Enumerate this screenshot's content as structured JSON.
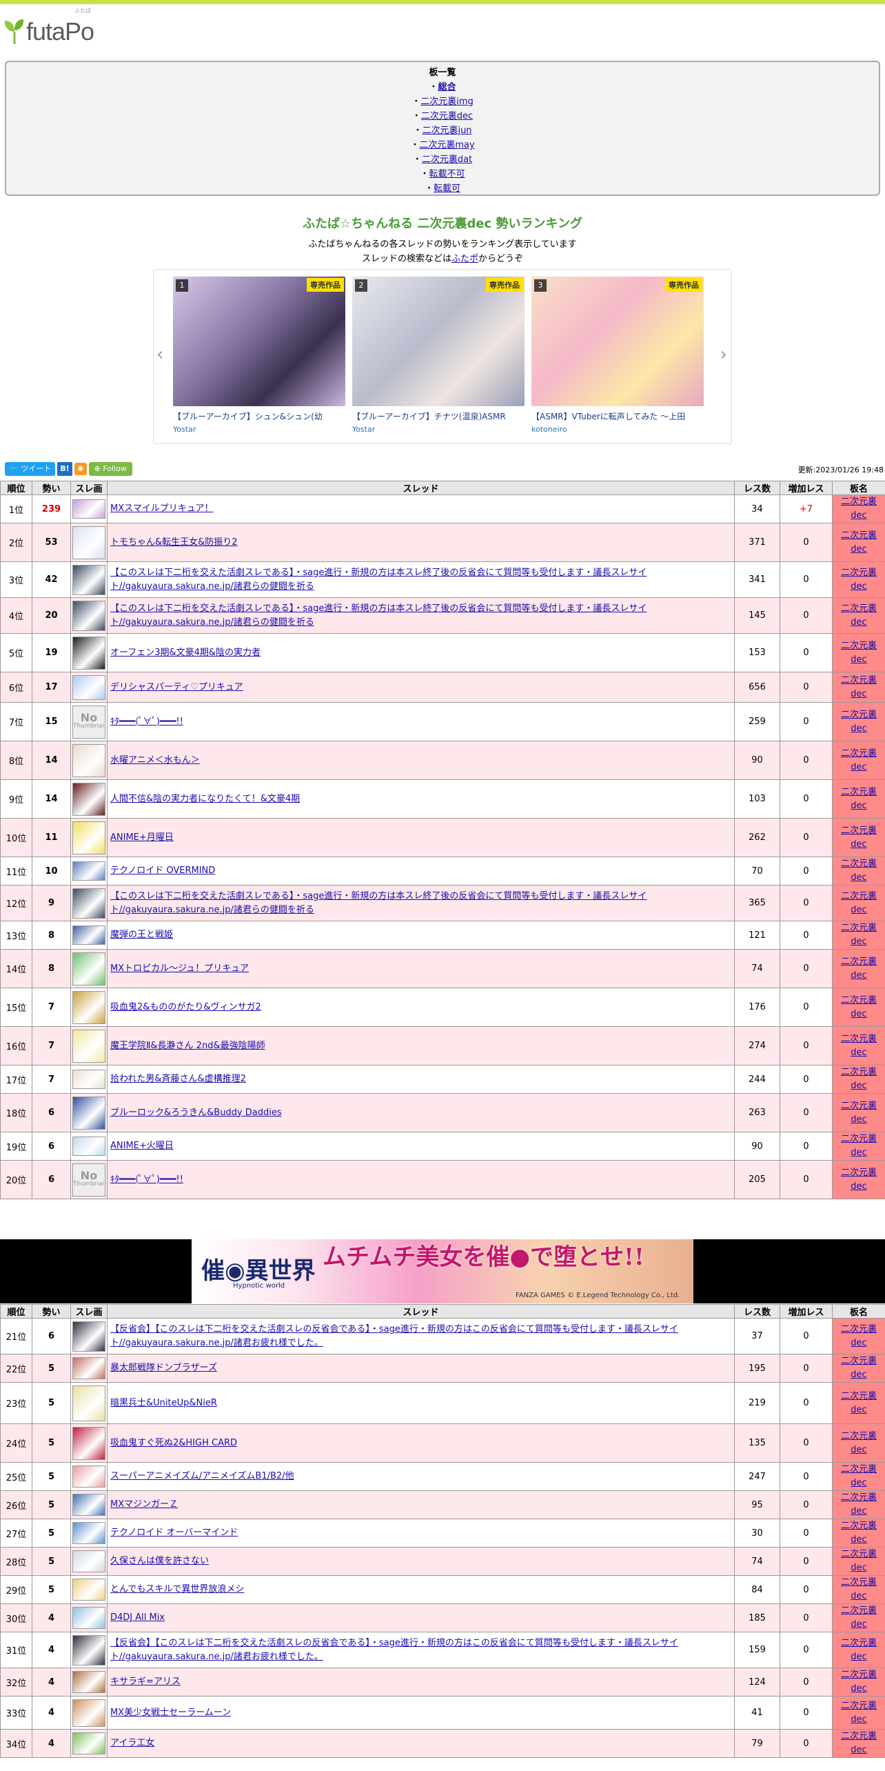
{
  "site": {
    "logo_text": "futaPo",
    "logo_ruby": "ふたぽ"
  },
  "boards": {
    "title": "板一覧",
    "items": [
      {
        "label": "総合",
        "current": true
      },
      {
        "label": "二次元裏img"
      },
      {
        "label": "二次元裏dec"
      },
      {
        "label": "二次元裏jun"
      },
      {
        "label": "二次元裏may"
      },
      {
        "label": "二次元裏dat"
      },
      {
        "label": "転載不可"
      },
      {
        "label": "転載可"
      }
    ]
  },
  "page": {
    "title": "ふたば☆ちゃんねる 二次元裏dec 勢いランキング",
    "desc1": "ふたばちゃんねるの各スレッドの勢いをランキング表示しています",
    "desc2_pre": "スレッドの検索などは",
    "desc2_link": "ふたポ",
    "desc2_post": "からどうぞ",
    "updated": "更新:2023/01/26 19:48"
  },
  "carousel": {
    "badge": "専売作品",
    "items": [
      {
        "rank": "1",
        "name": "【ブルーアーカイブ】シュン&シュン(幼",
        "maker": "Yostar"
      },
      {
        "rank": "2",
        "name": "【ブルーアーカイブ】チナツ(温泉)ASMR",
        "maker": "Yostar"
      },
      {
        "rank": "3",
        "name": "【ASMR】VTuberに転声してみた 〜上田",
        "maker": "kotoneiro"
      }
    ]
  },
  "social": {
    "tweet": "ツイート",
    "hatena": "B!",
    "follow": "Follow"
  },
  "table_headers": {
    "rank": "順位",
    "ikioi": "勢い",
    "thumb": "スレ画",
    "thread": "スレッド",
    "res": "レス数",
    "incr": "増加レス",
    "board": "板名"
  },
  "board_name_line1": "二次元裏",
  "board_name_line2": "dec",
  "rows_a": [
    {
      "rank": "1位",
      "ikioi": "239",
      "title": "MXスマイルプリキュア！",
      "res": "34",
      "incr": "+7"
    },
    {
      "rank": "2位",
      "ikioi": "53",
      "title": "トモちゃん&転生王女&防振り2",
      "res": "371",
      "incr": "0"
    },
    {
      "rank": "3位",
      "ikioi": "42",
      "title": "【このスレは下二桁を交えた活劇スレである】・sage進行・新規の方は本スレ終了後の反省会にて質問等も受付します・議長スレサイト//gakuyaura.sakura.ne.jp/諸君らの健闘を祈る",
      "res": "341",
      "incr": "0"
    },
    {
      "rank": "4位",
      "ikioi": "20",
      "title": "【このスレは下二桁を交えた活劇スレである】・sage進行・新規の方は本スレ終了後の反省会にて質問等も受付します・議長スレサイト//gakuyaura.sakura.ne.jp/諸君らの健闘を祈る",
      "res": "145",
      "incr": "0"
    },
    {
      "rank": "5位",
      "ikioi": "19",
      "title": "オーフェン3期&文豪4期&陰の実力者",
      "res": "153",
      "incr": "0"
    },
    {
      "rank": "6位",
      "ikioi": "17",
      "title": "デリシャスパーティ♡プリキュア",
      "res": "656",
      "incr": "0"
    },
    {
      "rank": "7位",
      "ikioi": "15",
      "title": "ｷﾀ━━━(ﾟ∀ﾟ)━━━!!",
      "res": "259",
      "incr": "0"
    },
    {
      "rank": "8位",
      "ikioi": "14",
      "title": "水曜アニメ＜水もん＞",
      "res": "90",
      "incr": "0"
    },
    {
      "rank": "9位",
      "ikioi": "14",
      "title": "人間不信&陰の実力者になりたくて！&文豪4期",
      "res": "103",
      "incr": "0"
    },
    {
      "rank": "10位",
      "ikioi": "11",
      "title": "ANIME+月曜日",
      "res": "262",
      "incr": "0"
    },
    {
      "rank": "11位",
      "ikioi": "10",
      "title": "テクノロイド OVERMIND",
      "res": "70",
      "incr": "0"
    },
    {
      "rank": "12位",
      "ikioi": "9",
      "title": "【このスレは下二桁を交えた活劇スレである】・sage進行・新規の方は本スレ終了後の反省会にて質問等も受付します・議長スレサイト//gakuyaura.sakura.ne.jp/諸君らの健闘を祈る",
      "res": "365",
      "incr": "0"
    },
    {
      "rank": "13位",
      "ikioi": "8",
      "title": "魔弾の王と戦姫",
      "res": "121",
      "incr": "0"
    },
    {
      "rank": "14位",
      "ikioi": "8",
      "title": "MXトロピカル～ジュ！プリキュア",
      "res": "74",
      "incr": "0"
    },
    {
      "rank": "15位",
      "ikioi": "7",
      "title": "吸血鬼2&もののがたり&ヴィンサガ2",
      "res": "176",
      "incr": "0"
    },
    {
      "rank": "16位",
      "ikioi": "7",
      "title": "魔王学院Ⅱ&長瀞さん 2nd&最強陰陽師",
      "res": "274",
      "incr": "0"
    },
    {
      "rank": "17位",
      "ikioi": "7",
      "title": "拾われた男&斉藤さん&虚構推理2",
      "res": "244",
      "incr": "0"
    },
    {
      "rank": "18位",
      "ikioi": "6",
      "title": "ブルーロック&ろうきん&Buddy Daddies",
      "res": "263",
      "incr": "0"
    },
    {
      "rank": "19位",
      "ikioi": "6",
      "title": "ANIME+火曜日",
      "res": "90",
      "incr": "0"
    },
    {
      "rank": "20位",
      "ikioi": "6",
      "title": "ｷﾀ━━━(ﾟ∀ﾟ)━━━!!",
      "res": "205",
      "incr": "0"
    }
  ],
  "rows_b": [
    {
      "rank": "21位",
      "ikioi": "6",
      "title": "【反省会】【このスレは下二桁を交えた活劇スレの反省会である】・sage進行・新規の方はこの反省会にて質問等も受付します・議長スレサイト//gakuyaura.sakura.ne.jp/諸君お疲れ様でした。",
      "res": "37",
      "incr": "0"
    },
    {
      "rank": "22位",
      "ikioi": "5",
      "title": "暴太郎戦隊ドンブラザーズ",
      "res": "195",
      "incr": "0"
    },
    {
      "rank": "23位",
      "ikioi": "5",
      "title": "暗黒兵士&UniteUp&NieR",
      "res": "219",
      "incr": "0"
    },
    {
      "rank": "24位",
      "ikioi": "5",
      "title": "吸血鬼すぐ死ぬ2&HIGH CARD",
      "res": "135",
      "incr": "0"
    },
    {
      "rank": "25位",
      "ikioi": "5",
      "title": "スーパーアニメイズム/アニメイズムB1/B2/他",
      "res": "247",
      "incr": "0"
    },
    {
      "rank": "26位",
      "ikioi": "5",
      "title": "MXマジンガーＺ",
      "res": "95",
      "incr": "0"
    },
    {
      "rank": "27位",
      "ikioi": "5",
      "title": "テクノロイド オーバーマインド",
      "res": "30",
      "incr": "0"
    },
    {
      "rank": "28位",
      "ikioi": "5",
      "title": "久保さんは僕を許さない",
      "res": "74",
      "incr": "0"
    },
    {
      "rank": "29位",
      "ikioi": "5",
      "title": "とんでもスキルで異世界放浪メシ",
      "res": "84",
      "incr": "0"
    },
    {
      "rank": "30位",
      "ikioi": "4",
      "title": "D4DJ All Mix",
      "res": "185",
      "incr": "0"
    },
    {
      "rank": "31位",
      "ikioi": "4",
      "title": "【反省会】【このスレは下二桁を交えた活劇スレの反省会である】・sage進行・新規の方はこの反省会にて質問等も受付します・議長スレサイト//gakuyaura.sakura.ne.jp/諸君お疲れ様でした。",
      "res": "159",
      "incr": "0"
    },
    {
      "rank": "32位",
      "ikioi": "4",
      "title": "キサラギ=アリス",
      "res": "124",
      "incr": "0"
    },
    {
      "rank": "33位",
      "ikioi": "4",
      "title": "MX美少女戦士セーラームーン",
      "res": "41",
      "incr": "0"
    },
    {
      "rank": "34位",
      "ikioi": "4",
      "title": "アイラ工女",
      "res": "79",
      "incr": "0"
    }
  ],
  "ad": {
    "logo": "催◉異世界",
    "logo_sub": "Hypnotic world",
    "text": "ムチムチ美女を催●で堕とせ!!",
    "credit": "FANZA GAMES © E.Legend Technology Co., Ltd."
  },
  "no_thumb": {
    "line1": "No",
    "line2": "Thumbnail"
  }
}
